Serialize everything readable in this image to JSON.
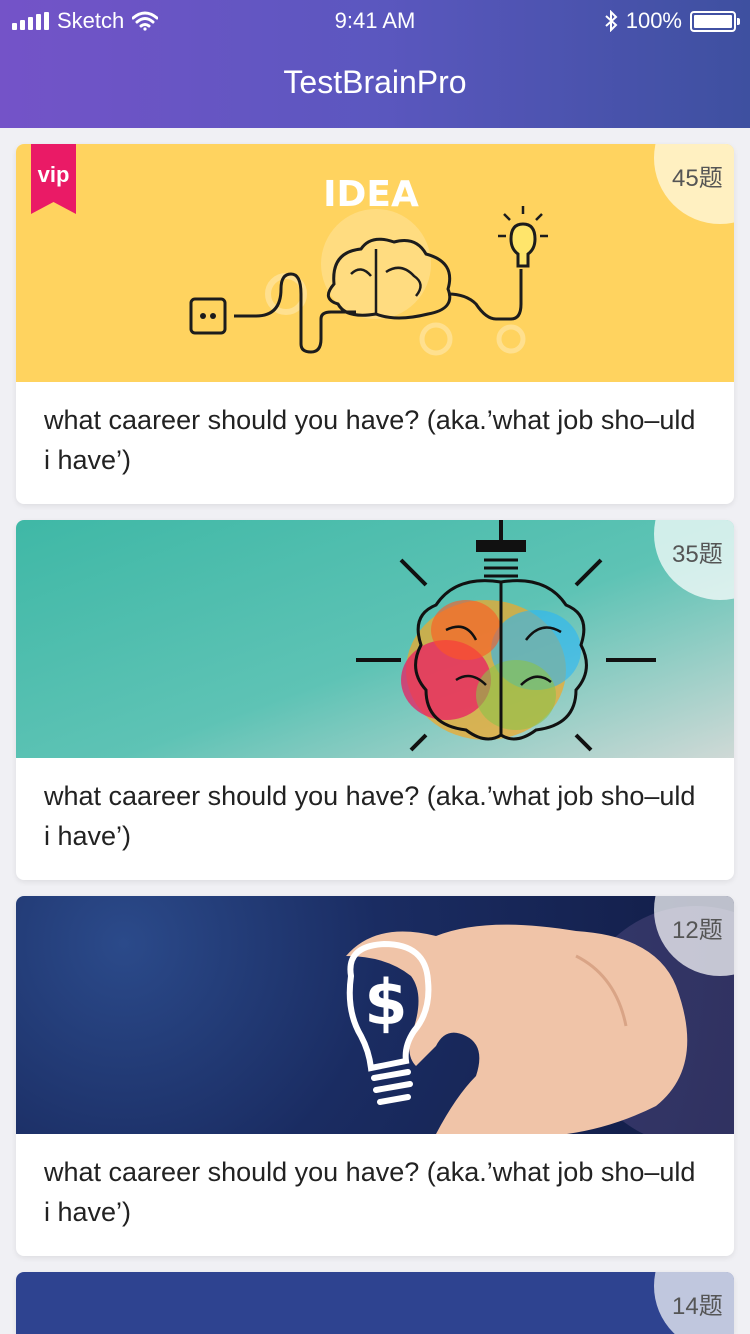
{
  "status_bar": {
    "carrier": "Sketch",
    "time": "9:41 AM",
    "battery_percent": "100%"
  },
  "header": {
    "title": "TestBrainPro"
  },
  "cards": [
    {
      "image_title": "IDEA",
      "badge": "vip",
      "count": "45题",
      "text": "what caareer should you have? (aka.’what job sho–uld i have’)"
    },
    {
      "count": "35题",
      "text": "what caareer should you have? (aka.’what job sho–uld i have’)"
    },
    {
      "count": "12题",
      "text": "what caareer should you have? (aka.’what job sho–uld i have’)"
    },
    {
      "count": "14题"
    }
  ],
  "colors": {
    "header_start": "#7453c8",
    "header_end": "#3e50a0",
    "card1_bg": "#ffd35f",
    "vip_badge": "#ea1a66",
    "card2_bg": "#4bb8a9",
    "card3_bg": "#1a2c62",
    "card4_bg": "#2e4390"
  }
}
